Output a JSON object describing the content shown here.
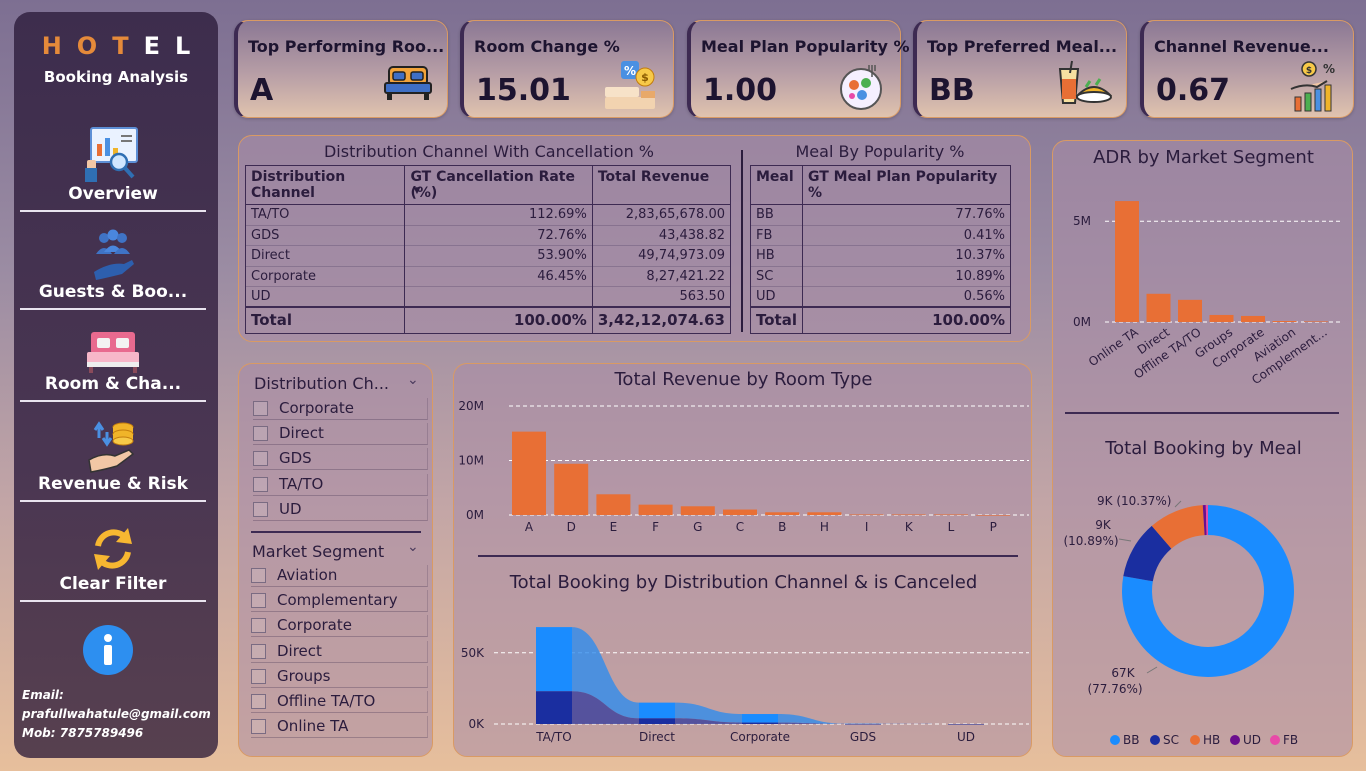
{
  "sidebar": {
    "logo": {
      "h": "H",
      "o": "O",
      "t": "T",
      "e": "E",
      "l": "L"
    },
    "subtitle": "Booking Analysis",
    "nav": [
      {
        "label": "Overview",
        "icon": "report-magnifier-icon"
      },
      {
        "label": "Guests & Boo...",
        "icon": "guests-icon"
      },
      {
        "label": "Room & Cha...",
        "icon": "bed-icon"
      },
      {
        "label": "Revenue & Risk",
        "icon": "money-hand-icon"
      },
      {
        "label": "Clear Filter",
        "icon": "refresh-icon"
      }
    ],
    "info_icon": "info-icon",
    "contact": {
      "email_label": "Email:",
      "email": "prafullwahatule@gmail.com",
      "mob": "Mob: 7875789496"
    }
  },
  "kpis": [
    {
      "title": "Top Performing Roo...",
      "value": "A",
      "icon": "bed-icon"
    },
    {
      "title": "Room Change %",
      "value": "15.01",
      "icon": "discount-coins-icon"
    },
    {
      "title": "Meal Plan Popularity %",
      "value": "1.00",
      "icon": "meal-plate-icon"
    },
    {
      "title": "Top Preferred Meal...",
      "value": "BB",
      "icon": "food-drink-icon"
    },
    {
      "title": "Channel Revenue...",
      "value": "0.67",
      "icon": "growth-chart-icon"
    }
  ],
  "dist_table": {
    "title": "Distribution Channel With Cancellation %",
    "headers": [
      "Distribution Channel",
      "GT Cancellation Rate (%)",
      "Total Revenue"
    ],
    "rows": [
      [
        "TA/TO",
        "112.69%",
        "2,83,65,678.00"
      ],
      [
        "GDS",
        "72.76%",
        "43,438.82"
      ],
      [
        "Direct",
        "53.90%",
        "49,74,973.09"
      ],
      [
        "Corporate",
        "46.45%",
        "8,27,421.22"
      ],
      [
        "UD",
        "",
        "563.50"
      ]
    ],
    "total": [
      "Total",
      "100.00%",
      "3,42,12,074.63"
    ]
  },
  "meal_table": {
    "title": "Meal By Popularity %",
    "headers": [
      "Meal",
      "GT Meal Plan Popularity %"
    ],
    "rows": [
      [
        "BB",
        "77.76%"
      ],
      [
        "FB",
        "0.41%"
      ],
      [
        "HB",
        "10.37%"
      ],
      [
        "SC",
        "10.89%"
      ],
      [
        "UD",
        "0.56%"
      ]
    ],
    "total": [
      "Total",
      "100.00%"
    ]
  },
  "slicers": {
    "distribution": {
      "title": "Distribution Ch...",
      "items": [
        "Corporate",
        "Direct",
        "GDS",
        "TA/TO",
        "UD"
      ]
    },
    "market": {
      "title": "Market Segment",
      "items": [
        "Aviation",
        "Complementary",
        "Corporate",
        "Direct",
        "Groups",
        "Offline TA/TO",
        "Online TA"
      ]
    }
  },
  "colors": {
    "bar": "#e86f35",
    "bb": "#1a8cff",
    "sc": "#1a2ea0",
    "hb": "#e86f35",
    "ud": "#6b0f8e",
    "fb": "#e84aa8"
  },
  "chart_data": [
    {
      "type": "bar",
      "title": "Total Revenue by Room Type",
      "categories": [
        "A",
        "D",
        "E",
        "F",
        "G",
        "C",
        "B",
        "H",
        "I",
        "K",
        "L",
        "P"
      ],
      "values": [
        15.3,
        9.4,
        3.8,
        1.9,
        1.6,
        1.0,
        0.5,
        0.5,
        0.1,
        0.1,
        0.1,
        0.0
      ],
      "unit": "M",
      "yticks": [
        "0M",
        "10M",
        "20M"
      ],
      "ylim": [
        0,
        20
      ]
    },
    {
      "type": "bar",
      "title": "ADR by Market Segment",
      "categories": [
        "Online TA",
        "Direct",
        "Offline TA/TO",
        "Groups",
        "Corporate",
        "Aviation",
        "Complement..."
      ],
      "values": [
        6.0,
        1.4,
        1.1,
        0.35,
        0.3,
        0.05,
        0.03
      ],
      "unit": "M",
      "yticks": [
        "0M",
        "5M"
      ],
      "ylim": [
        0,
        6.5
      ]
    },
    {
      "type": "area",
      "title": "Total Booking by Distribution Channel & is Canceled",
      "categories": [
        "TA/TO",
        "Direct",
        "Corporate",
        "GDS",
        "UD"
      ],
      "series": [
        {
          "values": [
            68,
            15,
            7,
            0.2,
            0.005
          ]
        },
        {
          "values": [
            23,
            4,
            1,
            0.05,
            0.001
          ]
        }
      ],
      "yticks": [
        "0K",
        "50K"
      ],
      "ylim": [
        0,
        80
      ]
    },
    {
      "type": "pie",
      "title": "Total Booking by Meal",
      "slices": [
        {
          "name": "BB",
          "value": 77.76,
          "label": "67K",
          "pct": "(77.76%)"
        },
        {
          "name": "SC",
          "value": 10.89,
          "label": "9K",
          "pct": "(10.89%)"
        },
        {
          "name": "HB",
          "value": 10.37,
          "label": "9K",
          "pct": "(10.37%)"
        },
        {
          "name": "UD",
          "value": 0.56
        },
        {
          "name": "FB",
          "value": 0.41
        }
      ],
      "legend": [
        "BB",
        "SC",
        "HB",
        "UD",
        "FB"
      ]
    }
  ]
}
